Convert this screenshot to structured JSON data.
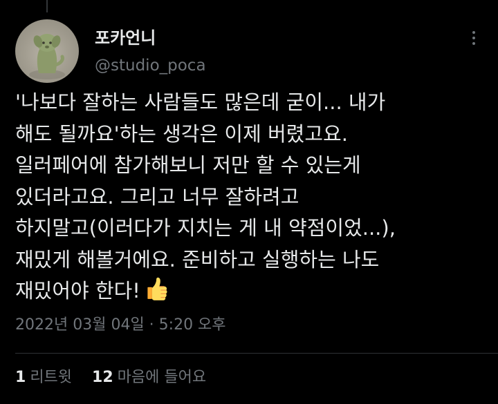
{
  "theme": {
    "background": "#000000",
    "text_primary": "#e7e9ea",
    "text_secondary": "#71767b",
    "divider": "#2f3336"
  },
  "author": {
    "display_name": "포카언니",
    "handle": "@studio_poca",
    "avatar_icon": "clay-dog-figurine-avatar"
  },
  "more_icon": "more-horizontal-icon",
  "tweet": {
    "lines": [
      "'나보다 잘하는 사람들도 많은데 굳이... 내가",
      "해도 될까요'하는 생각은 이제 버렸고요.",
      "일러페어에 참가해보니 저만 할 수 있는게",
      "있더라고요. 그리고 너무 잘하려고",
      "하지말고(이러다가 지치는 게 내 약점이었...),",
      "재밌게 해볼거에요. 준비하고 실행하는 나도",
      "재밌어야 한다!"
    ],
    "emoji": "thumbs-up-icon",
    "timestamp": "2022년 03월 04일 · 5:20 오후"
  },
  "stats": {
    "retweets": {
      "count": "1",
      "label": "리트윗"
    },
    "likes": {
      "count": "12",
      "label": "마음에 들어요"
    }
  }
}
